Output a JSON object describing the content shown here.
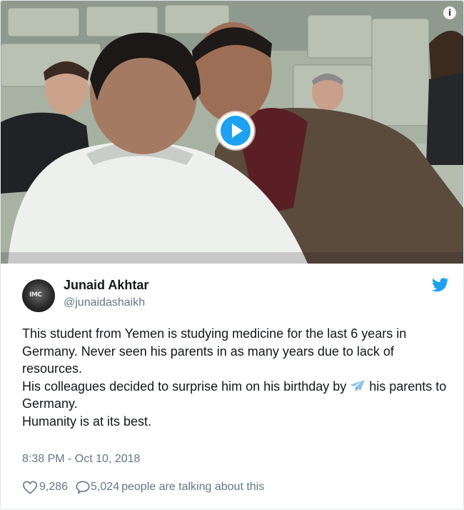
{
  "media": {
    "play_icon": "play-icon",
    "info_icon": "info-icon",
    "info_glyph": "i"
  },
  "tweet": {
    "display_name": "Junaid Akhtar",
    "handle": "@junaidashaikh",
    "avatar_text": "IMC",
    "paragraphs": [
      "This student from Yemen is studying medicine for the last 6 years in Germany. Never seen his parents in as many years due to lack of resources.",
      "His colleagues decided to surprise him on his birthday by",
      "his parents to Germany.",
      "Humanity is at its best."
    ],
    "timestamp": "8:38 PM - Oct 10, 2018",
    "likes": "9,286",
    "replies": "5,024",
    "talking_text": "people are talking about this"
  },
  "colors": {
    "accent": "#1da1f2",
    "muted": "#657786",
    "text": "#14171a"
  }
}
